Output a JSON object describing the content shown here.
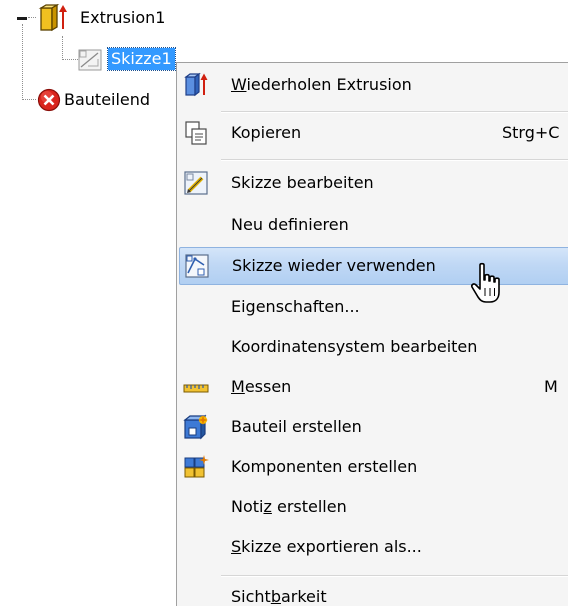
{
  "tree": {
    "nodes": [
      {
        "id": "extrusion",
        "label": "Extrusion1",
        "icon": "extrusion-icon"
      },
      {
        "id": "sketch",
        "label": "Skizze1",
        "icon": "sketch-icon",
        "selected": true
      },
      {
        "id": "part-end",
        "label": "Bauteilend",
        "icon": "error-icon"
      }
    ]
  },
  "menu": {
    "items": [
      {
        "id": "repeat-extrusion",
        "pre": "",
        "mnemonic": "W",
        "post": "iederholen Extrusion",
        "shortcut": "",
        "icon": "extrusion-icon"
      },
      {
        "id": "copy",
        "pre": "Kopieren",
        "mnemonic": "",
        "post": "",
        "shortcut": "Strg+C",
        "icon": "copy-icon"
      },
      {
        "id": "edit-sketch",
        "pre": "Skizze bearbeiten",
        "mnemonic": "",
        "post": "",
        "shortcut": "",
        "icon": "edit-sketch-icon"
      },
      {
        "id": "redefine",
        "pre": "Neu definieren",
        "mnemonic": "",
        "post": "",
        "shortcut": "",
        "icon": ""
      },
      {
        "id": "reuse-sketch",
        "pre": "Skizze wieder verwenden",
        "mnemonic": "",
        "post": "",
        "shortcut": "",
        "icon": "reuse-sketch-icon",
        "hover": true
      },
      {
        "id": "properties",
        "pre": "Eigenschaften...",
        "mnemonic": "",
        "post": "",
        "shortcut": "",
        "icon": ""
      },
      {
        "id": "edit-coordsys",
        "pre": "Koordinatensystem bearbeiten",
        "mnemonic": "",
        "post": "",
        "shortcut": "",
        "icon": ""
      },
      {
        "id": "measure",
        "pre": "",
        "mnemonic": "M",
        "post": "essen",
        "shortcut": "M",
        "icon": "ruler-icon"
      },
      {
        "id": "create-part",
        "pre": "Bauteil erstellen",
        "mnemonic": "",
        "post": "",
        "shortcut": "",
        "icon": "create-part-icon"
      },
      {
        "id": "create-components",
        "pre": "Komponenten erstellen",
        "mnemonic": "",
        "post": "",
        "shortcut": "",
        "icon": "create-components-icon"
      },
      {
        "id": "create-note",
        "pre": "Noti",
        "mnemonic": "z",
        "post": " erstellen",
        "shortcut": "",
        "icon": ""
      },
      {
        "id": "export-sketch",
        "pre": "",
        "mnemonic": "S",
        "post": "kizze exportieren als...",
        "shortcut": "",
        "icon": ""
      },
      {
        "id": "visibility",
        "pre": "Sicht",
        "mnemonic": "b",
        "post": "arkeit",
        "shortcut": "",
        "icon": ""
      }
    ]
  },
  "colors": {
    "selection": "#3399ff",
    "hover_top": "#d4e5f9",
    "hover_bottom": "#b1cff2",
    "menu_bg": "#f5f5f5"
  },
  "cursor": {
    "icon": "hand-pointer-icon"
  }
}
